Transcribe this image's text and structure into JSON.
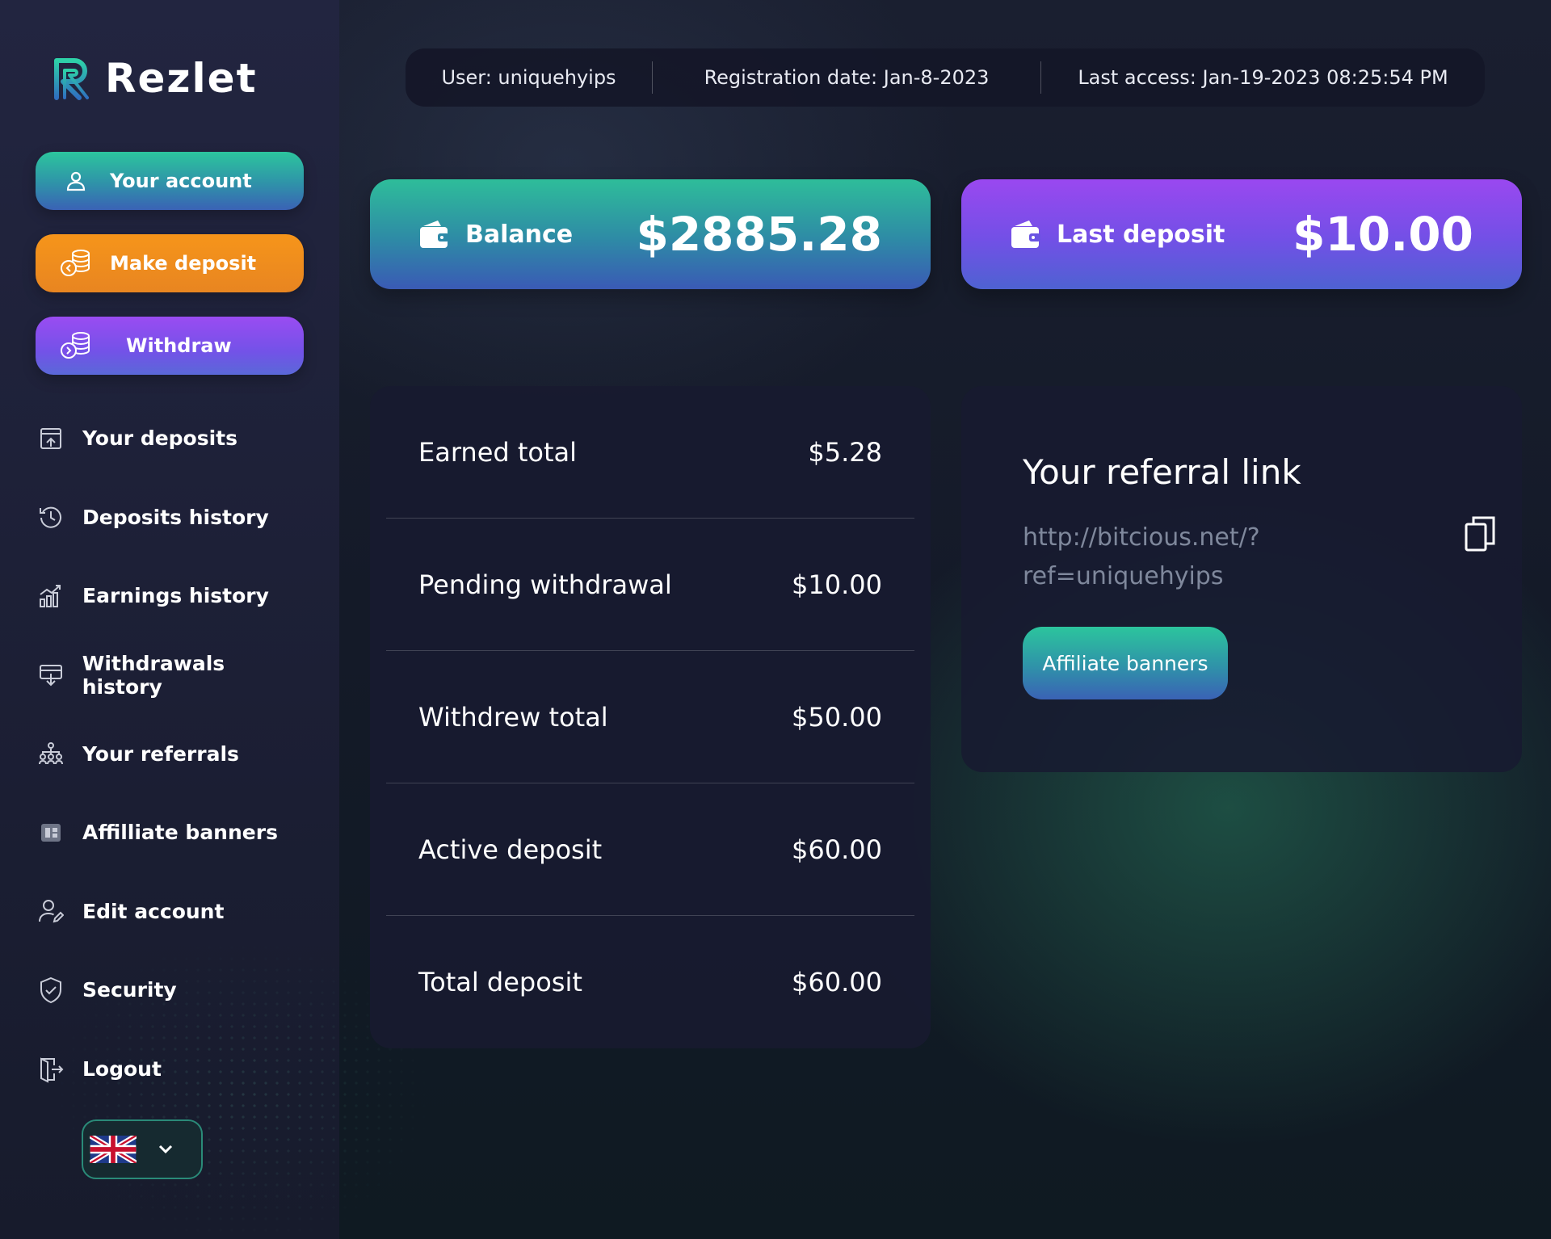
{
  "brand": {
    "name": "Rezlet"
  },
  "sidebar": {
    "primary_buttons": {
      "your_account": "Your account",
      "make_deposit": "Make deposit",
      "withdraw": "Withdraw"
    },
    "nav_items": [
      {
        "label": "Your deposits",
        "icon": "deposit-box-icon"
      },
      {
        "label": "Deposits history",
        "icon": "history-clock-icon"
      },
      {
        "label": "Earnings history",
        "icon": "chart-bars-icon"
      },
      {
        "label": "Withdrawals history",
        "icon": "card-withdraw-icon"
      },
      {
        "label": "Your referrals",
        "icon": "referrals-tree-icon"
      },
      {
        "label": "Affilliate banners",
        "icon": "banner-icon"
      },
      {
        "label": "Edit account",
        "icon": "user-edit-icon"
      },
      {
        "label": "Security",
        "icon": "shield-check-icon"
      },
      {
        "label": "Logout",
        "icon": "door-exit-icon"
      }
    ],
    "language": {
      "selected": "UK flag",
      "icon": "chevron-down-icon"
    }
  },
  "topbar": {
    "user": "User: uniquehyips",
    "registration": "Registration date: Jan-8-2023",
    "last_access": "Last access: Jan-19-2023 08:25:54 PM"
  },
  "cards": {
    "balance": {
      "label": "Balance",
      "amount": "$2885.28"
    },
    "last_deposit": {
      "label": "Last deposit",
      "amount": "$10.00"
    }
  },
  "stats": [
    {
      "label": "Earned total",
      "value": "$5.28"
    },
    {
      "label": "Pending withdrawal",
      "value": "$10.00"
    },
    {
      "label": "Withdrew total",
      "value": "$50.00"
    },
    {
      "label": "Active deposit",
      "value": "$60.00"
    },
    {
      "label": "Total deposit",
      "value": "$60.00"
    }
  ],
  "referral": {
    "title": "Your referral link",
    "link_line1": "http://bitcious.net/?",
    "link_line2": "ref=uniquehyips",
    "button": "Affiliate banners"
  },
  "colors": {
    "teal_accent": "#2cc59d",
    "orange_accent": "#f6951a",
    "purple_accent": "#9a4cf2",
    "panel_bg": "#181a30"
  }
}
